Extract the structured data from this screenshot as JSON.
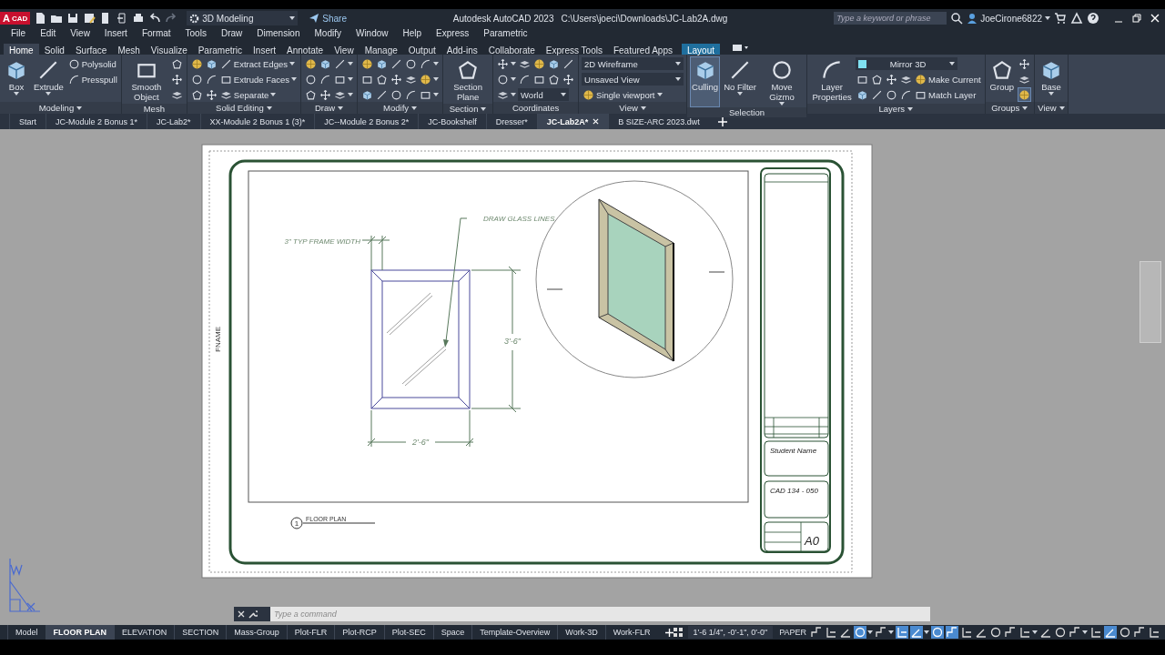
{
  "title_bar": {
    "logo_letter": "A",
    "logo_label": "CAD",
    "workspace": "3D Modeling",
    "share": "Share",
    "app_title": "Autodesk AutoCAD 2023",
    "file_path": "C:\\Users\\joeci\\Downloads\\JC-Lab2A.dwg",
    "search_placeholder": "Type a keyword or phrase",
    "user": "JoeCirone6822"
  },
  "menu": [
    "File",
    "Edit",
    "View",
    "Insert",
    "Format",
    "Tools",
    "Draw",
    "Dimension",
    "Modify",
    "Window",
    "Help",
    "Express",
    "Parametric"
  ],
  "ribbon_tabs": [
    {
      "label": "Home",
      "selected": true,
      "kind": "normal"
    },
    {
      "label": "Solid",
      "selected": false,
      "kind": "normal"
    },
    {
      "label": "Surface",
      "selected": false,
      "kind": "normal"
    },
    {
      "label": "Mesh",
      "selected": false,
      "kind": "normal"
    },
    {
      "label": "Visualize",
      "selected": false,
      "kind": "normal"
    },
    {
      "label": "Parametric",
      "selected": false,
      "kind": "normal"
    },
    {
      "label": "Insert",
      "selected": false,
      "kind": "normal"
    },
    {
      "label": "Annotate",
      "selected": false,
      "kind": "normal"
    },
    {
      "label": "View",
      "selected": false,
      "kind": "normal"
    },
    {
      "label": "Manage",
      "selected": false,
      "kind": "normal"
    },
    {
      "label": "Output",
      "selected": false,
      "kind": "normal"
    },
    {
      "label": "Add-ins",
      "selected": false,
      "kind": "normal"
    },
    {
      "label": "Collaborate",
      "selected": false,
      "kind": "normal"
    },
    {
      "label": "Express Tools",
      "selected": false,
      "kind": "normal"
    },
    {
      "label": "Featured Apps",
      "selected": false,
      "kind": "normal"
    },
    {
      "label": "Layout",
      "selected": false,
      "kind": "contextual"
    }
  ],
  "ribbon_panels": [
    {
      "title": "Modeling",
      "menu": true,
      "large": [
        {
          "label": "Box",
          "dropdown": true
        },
        {
          "label": "Extrude",
          "dropdown": true
        }
      ],
      "rows": [
        [
          {
            "kind": "small",
            "label": "Polysolid"
          }
        ],
        [
          {
            "kind": "small",
            "label": "Presspull"
          }
        ]
      ]
    },
    {
      "title": "Mesh",
      "menu": false,
      "large": [
        {
          "label": "Smooth Object",
          "dropdown": false
        }
      ],
      "rows": [
        [
          {
            "kind": "icon"
          }
        ],
        [
          {
            "kind": "icon"
          }
        ],
        [
          {
            "kind": "icon"
          }
        ]
      ]
    },
    {
      "title": "Solid Editing",
      "menu": true,
      "rows": [
        [
          {
            "kind": "icon"
          },
          {
            "kind": "icon"
          },
          {
            "kind": "small",
            "label": "Extract Edges",
            "dropdown": true
          }
        ],
        [
          {
            "kind": "icon"
          },
          {
            "kind": "icon"
          },
          {
            "kind": "small",
            "label": "Extrude Faces",
            "dropdown": true
          }
        ],
        [
          {
            "kind": "icon"
          },
          {
            "kind": "icon"
          },
          {
            "kind": "small",
            "label": "Separate",
            "dropdown": true
          }
        ]
      ]
    },
    {
      "title": "Draw",
      "menu": true,
      "rows": [
        [
          {
            "kind": "icon"
          },
          {
            "kind": "icon"
          },
          {
            "kind": "icon",
            "dropdown": true
          }
        ],
        [
          {
            "kind": "icon"
          },
          {
            "kind": "icon"
          },
          {
            "kind": "icon",
            "dropdown": true
          }
        ],
        [
          {
            "kind": "icon"
          },
          {
            "kind": "icon"
          },
          {
            "kind": "icon",
            "dropdown": true
          }
        ]
      ]
    },
    {
      "title": "Modify",
      "menu": true,
      "rows": [
        [
          {
            "kind": "icon"
          },
          {
            "kind": "icon"
          },
          {
            "kind": "icon"
          },
          {
            "kind": "icon"
          },
          {
            "kind": "icon",
            "dropdown": true
          }
        ],
        [
          {
            "kind": "icon"
          },
          {
            "kind": "icon"
          },
          {
            "kind": "icon"
          },
          {
            "kind": "icon"
          },
          {
            "kind": "icon",
            "dropdown": true
          }
        ],
        [
          {
            "kind": "icon"
          },
          {
            "kind": "icon"
          },
          {
            "kind": "icon"
          },
          {
            "kind": "icon"
          },
          {
            "kind": "icon",
            "dropdown": true
          }
        ]
      ]
    },
    {
      "title": "Section",
      "menu": true,
      "large": [
        {
          "label": "Section Plane",
          "dropdown": false
        }
      ]
    },
    {
      "title": "Coordinates",
      "menu": false,
      "rows": [
        [
          {
            "kind": "icon",
            "dropdown": true
          },
          {
            "kind": "icon"
          },
          {
            "kind": "icon"
          },
          {
            "kind": "icon"
          },
          {
            "kind": "icon"
          }
        ],
        [
          {
            "kind": "icon",
            "dropdown": true
          },
          {
            "kind": "icon"
          },
          {
            "kind": "icon"
          },
          {
            "kind": "icon"
          },
          {
            "kind": "icon"
          }
        ],
        [
          {
            "kind": "icon",
            "dropdown": true
          },
          {
            "kind": "dropdown",
            "label": "World"
          }
        ]
      ]
    },
    {
      "title": "View",
      "menu": true,
      "rows": [
        [
          {
            "kind": "dropdown",
            "label": "2D Wireframe"
          }
        ],
        [
          {
            "kind": "dropdown",
            "label": "Unsaved View"
          }
        ],
        [
          {
            "kind": "small",
            "label": "Single viewport",
            "dropdown": true
          }
        ]
      ]
    },
    {
      "title": "Selection",
      "menu": false,
      "large": [
        {
          "label": "Culling",
          "dropdown": false,
          "on": true
        },
        {
          "label": "No Filter",
          "dropdown": true,
          "on": false
        },
        {
          "label": "Move Gizmo",
          "dropdown": true,
          "on": false
        }
      ]
    },
    {
      "title": "Layers",
      "menu": true,
      "large": [
        {
          "label": "Layer Properties",
          "dropdown": false
        }
      ],
      "rows": [
        [
          {
            "kind": "layer",
            "label": "Mirror 3D"
          }
        ],
        [
          {
            "kind": "icon"
          },
          {
            "kind": "icon"
          },
          {
            "kind": "icon"
          },
          {
            "kind": "icon"
          },
          {
            "kind": "small",
            "label": "Make Current"
          }
        ],
        [
          {
            "kind": "icon"
          },
          {
            "kind": "icon"
          },
          {
            "kind": "icon"
          },
          {
            "kind": "icon"
          },
          {
            "kind": "small",
            "label": "Match Layer"
          }
        ]
      ]
    },
    {
      "title": "Groups",
      "menu": true,
      "large": [
        {
          "label": "Group",
          "dropdown": false
        }
      ],
      "rows": [
        [
          {
            "kind": "icon",
            "on": false
          }
        ],
        [
          {
            "kind": "icon",
            "on": false
          }
        ],
        [
          {
            "kind": "icon",
            "on": true
          }
        ]
      ]
    },
    {
      "title": "View",
      "menu": true,
      "large": [
        {
          "label": "Base",
          "dropdown": true
        }
      ]
    }
  ],
  "file_tabs": [
    {
      "label": "Start",
      "selected": false
    },
    {
      "label": "JC-Module 2  Bonus 1*",
      "selected": false
    },
    {
      "label": "JC-Lab2*",
      "selected": false
    },
    {
      "label": "XX-Module 2  Bonus 1 (3)*",
      "selected": false
    },
    {
      "label": "JC--Module 2  Bonus 2*",
      "selected": false
    },
    {
      "label": "JC-Bookshelf",
      "selected": false
    },
    {
      "label": "Dresser*",
      "selected": false
    },
    {
      "label": "JC-Lab2A*",
      "selected": true
    },
    {
      "label": "B SIZE-ARC 2023.dwt",
      "selected": false
    }
  ],
  "drawing": {
    "leader_note": "DRAW GLASS LINES",
    "frame_note": "3\" TYP FRAME WIDTH",
    "height_dim": "3'-6\"",
    "width_dim": "2'-6\"",
    "sheet_label": "FNAME",
    "view_number": "1",
    "view_title": "FLOOR PLAN",
    "student_name": "Student Name",
    "course": "CAD 134 - 050",
    "sheet_number": "A0"
  },
  "command_line": {
    "placeholder": "Type a command"
  },
  "layout_tabs": [
    {
      "label": "Model",
      "selected": false
    },
    {
      "label": "FLOOR PLAN",
      "selected": true
    },
    {
      "label": "ELEVATION",
      "selected": false
    },
    {
      "label": "SECTION",
      "selected": false
    },
    {
      "label": "Mass-Group",
      "selected": false
    },
    {
      "label": "Plot-FLR",
      "selected": false
    },
    {
      "label": "Plot-RCP",
      "selected": false
    },
    {
      "label": "Plot-SEC",
      "selected": false
    },
    {
      "label": "Space",
      "selected": false
    },
    {
      "label": "Template-Overview",
      "selected": false
    },
    {
      "label": "Work-3D",
      "selected": false
    },
    {
      "label": "Work-FLR",
      "selected": false
    }
  ],
  "status_bar": {
    "coordinates": "1'-6 1/4\", -0'-1\", 0'-0\"",
    "space": "PAPER",
    "toggles": [
      {
        "on": false,
        "dropdown": false
      },
      {
        "on": false,
        "dropdown": false
      },
      {
        "on": false,
        "dropdown": false
      },
      {
        "on": true,
        "dropdown": true
      },
      {
        "on": false,
        "dropdown": true
      },
      {
        "on": true,
        "dropdown": false
      },
      {
        "on": true,
        "dropdown": true
      },
      {
        "on": true,
        "dropdown": false
      },
      {
        "on": true,
        "dropdown": false
      },
      {
        "on": false,
        "dropdown": false
      },
      {
        "on": false,
        "dropdown": false
      },
      {
        "on": false,
        "dropdown": false
      },
      {
        "on": false,
        "dropdown": false
      },
      {
        "on": false,
        "dropdown": true
      },
      {
        "on": false,
        "dropdown": false
      },
      {
        "on": false,
        "dropdown": false
      },
      {
        "on": false,
        "dropdown": true
      },
      {
        "on": false,
        "dropdown": false
      },
      {
        "on": true,
        "dropdown": false
      },
      {
        "on": false,
        "dropdown": false
      },
      {
        "on": false,
        "dropdown": false
      },
      {
        "on": false,
        "dropdown": false
      }
    ]
  }
}
